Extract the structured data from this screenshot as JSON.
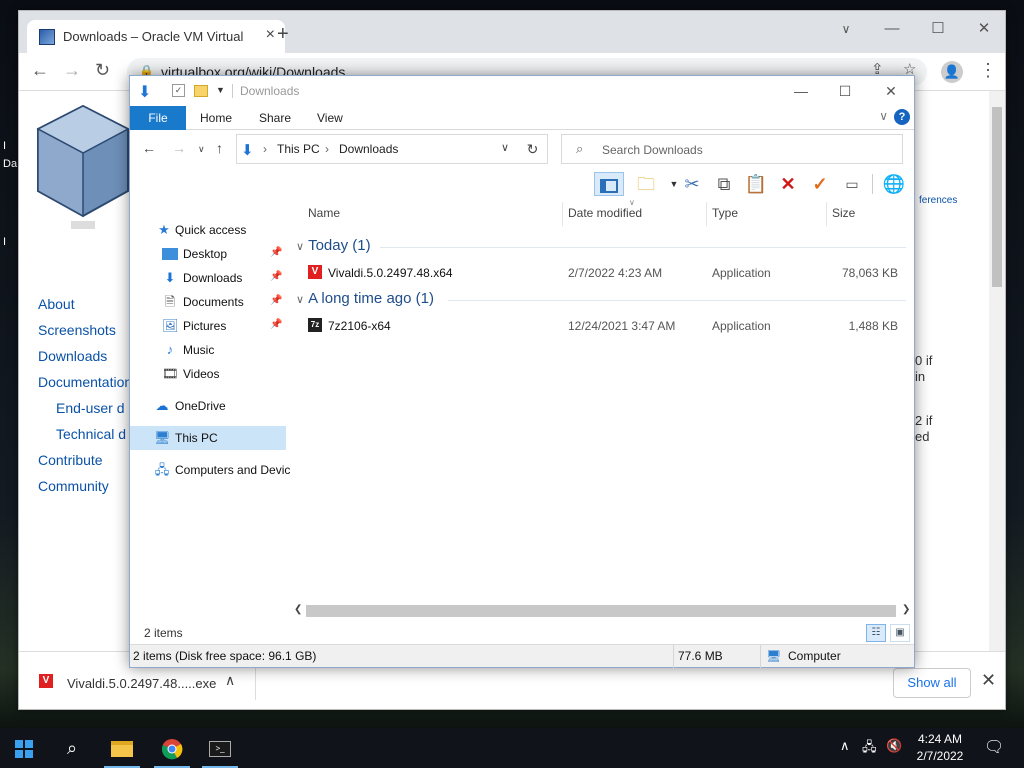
{
  "desktop": {
    "labels": [
      "I",
      "Da",
      "I"
    ]
  },
  "browser": {
    "tab_title": "Downloads – Oracle VM VirtualB",
    "url": "virtualbox.org/wiki/Downloads",
    "nav": [
      "About",
      "Screenshots",
      "Downloads",
      "Documentation",
      "End-user d",
      "Technical d",
      "Contribute",
      "Community"
    ],
    "side_fragments": [
      "ferences",
      "0 if",
      "in",
      "2 if",
      "ed"
    ],
    "shelf": {
      "file": "Vivaldi.5.0.2497.48.....exe",
      "show_all": "Show all"
    }
  },
  "explorer": {
    "title": "Downloads",
    "ribbon_tabs": [
      "File",
      "Home",
      "Share",
      "View"
    ],
    "breadcrumb": [
      "This PC",
      "Downloads"
    ],
    "search_placeholder": "Search Downloads",
    "nav_pane": [
      {
        "label": "Quick access",
        "icon": "star-icon"
      },
      {
        "label": "Desktop",
        "icon": "desktop-folder-icon",
        "pinned": true
      },
      {
        "label": "Downloads",
        "icon": "downloads-folder-icon",
        "pinned": true
      },
      {
        "label": "Documents",
        "icon": "documents-folder-icon",
        "pinned": true
      },
      {
        "label": "Pictures",
        "icon": "pictures-folder-icon",
        "pinned": true
      },
      {
        "label": "Music",
        "icon": "music-folder-icon"
      },
      {
        "label": "Videos",
        "icon": "videos-folder-icon"
      },
      {
        "label": "OneDrive",
        "icon": "cloud-icon"
      },
      {
        "label": "This PC",
        "icon": "computer-icon",
        "selected": true
      },
      {
        "label": "Computers and Devic",
        "icon": "network-icon"
      }
    ],
    "columns": [
      "Name",
      "Date modified",
      "Type",
      "Size"
    ],
    "groups": [
      {
        "label": "Today (1)",
        "files": [
          {
            "name": "Vivaldi.5.0.2497.48.x64",
            "date": "2/7/2022 4:23 AM",
            "type": "Application",
            "size": "78,063 KB",
            "icon": "vivaldi-icon"
          }
        ]
      },
      {
        "label": "A long time ago (1)",
        "files": [
          {
            "name": "7z2106-x64",
            "date": "12/24/2021 3:47 AM",
            "type": "Application",
            "size": "1,488 KB",
            "icon": "7zip-icon"
          }
        ]
      }
    ],
    "status_items": "2 items",
    "status_bar": {
      "left": "2 items (Disk free space: 96.1 GB)",
      "mid": "77.6 MB",
      "right": "Computer"
    }
  },
  "taskbar": {
    "apps": [
      "windows-start-icon",
      "search-icon",
      "file-explorer-icon",
      "chrome-icon",
      "terminal-icon"
    ],
    "time": "4:24 AM",
    "date": "2/7/2022"
  },
  "colors": {
    "accent": "#1979ca",
    "link": "#0a52a8",
    "taskbar": "#101319"
  }
}
